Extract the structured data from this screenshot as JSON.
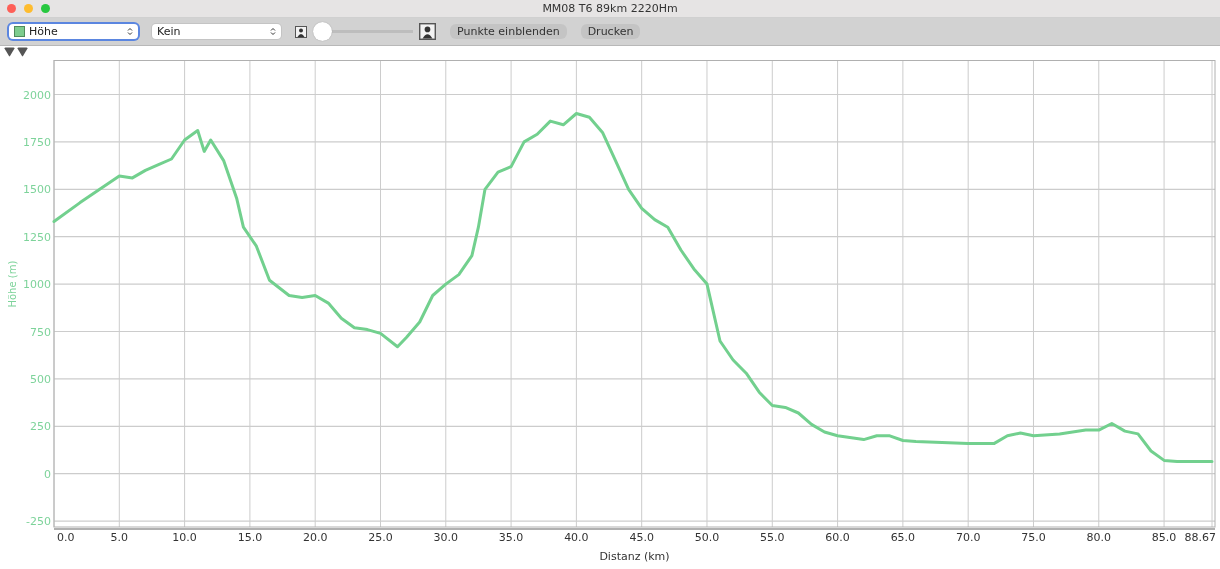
{
  "window": {
    "title": "MM08 T6 89km 2220Hm"
  },
  "toolbar": {
    "selects": [
      {
        "value": "Höhe",
        "focused": true,
        "swatch": true
      },
      {
        "value": "Kein",
        "focused": false,
        "swatch": false
      }
    ],
    "zoom_slider": {
      "level": 0.0
    },
    "buttons": [
      "Punkte einblenden",
      "Drucken"
    ]
  },
  "chart": {
    "chart_data": {
      "type": "line",
      "xlabel": "Distanz (km)",
      "ylabel": "Höhe (m)",
      "xlim": [
        0,
        88.67
      ],
      "ylim": [
        -281,
        2182
      ],
      "x": [
        0,
        2,
        3.5,
        5,
        6,
        7,
        8,
        9,
        10,
        11,
        11.5,
        12,
        13,
        14,
        14.5,
        15.5,
        16.5,
        18,
        19,
        20,
        21,
        22,
        23,
        24,
        25,
        26.3,
        27,
        28,
        29,
        30,
        31,
        32,
        32.5,
        33,
        34,
        35,
        36,
        37,
        38,
        39,
        40,
        41,
        42,
        43,
        44,
        45,
        46,
        47,
        48,
        49,
        50,
        50.5,
        51,
        52,
        53,
        54,
        55,
        56,
        57,
        58,
        59,
        60,
        62,
        63,
        64,
        65,
        66,
        68,
        70,
        72,
        73,
        74,
        75,
        77,
        79,
        80,
        81,
        82,
        83,
        84,
        85,
        86,
        88.67
      ],
      "series": [
        {
          "color": "#72d08e",
          "values": [
            1330,
            1430,
            1500,
            1570,
            1560,
            1600,
            1630,
            1660,
            1760,
            1810,
            1700,
            1760,
            1650,
            1450,
            1300,
            1200,
            1020,
            940,
            930,
            940,
            900,
            820,
            770,
            760,
            740,
            670,
            720,
            800,
            940,
            1000,
            1050,
            1150,
            1300,
            1500,
            1590,
            1620,
            1750,
            1790,
            1860,
            1840,
            1900,
            1880,
            1800,
            1650,
            1500,
            1400,
            1340,
            1300,
            1180,
            1080,
            1000,
            850,
            700,
            600,
            530,
            430,
            360,
            350,
            320,
            260,
            220,
            200,
            180,
            200,
            200,
            175,
            170,
            165,
            160,
            160,
            200,
            215,
            200,
            210,
            230,
            230,
            265,
            225,
            210,
            120,
            70,
            65,
            65
          ]
        }
      ],
      "xticks": [
        {
          "value": 0,
          "label": "0.0"
        },
        {
          "value": 5,
          "label": "5.0"
        },
        {
          "value": 10,
          "label": "10.0"
        },
        {
          "value": 15,
          "label": "15.0"
        },
        {
          "value": 20,
          "label": "20.0"
        },
        {
          "value": 25,
          "label": "25.0"
        },
        {
          "value": 30,
          "label": "30.0"
        },
        {
          "value": 35,
          "label": "35.0"
        },
        {
          "value": 40,
          "label": "40.0"
        },
        {
          "value": 45,
          "label": "45.0"
        },
        {
          "value": 50,
          "label": "50.0"
        },
        {
          "value": 55,
          "label": "55.0"
        },
        {
          "value": 60,
          "label": "60.0"
        },
        {
          "value": 65,
          "label": "65.0"
        },
        {
          "value": 70,
          "label": "70.0"
        },
        {
          "value": 75,
          "label": "75.0"
        },
        {
          "value": 80,
          "label": "80.0"
        },
        {
          "value": 85,
          "label": "85.0"
        },
        {
          "value": 88.67,
          "label": "88.67"
        }
      ],
      "yticks": [
        -250,
        0,
        250,
        500,
        750,
        1000,
        1250,
        1500,
        1750,
        2000
      ],
      "grid": true
    }
  }
}
